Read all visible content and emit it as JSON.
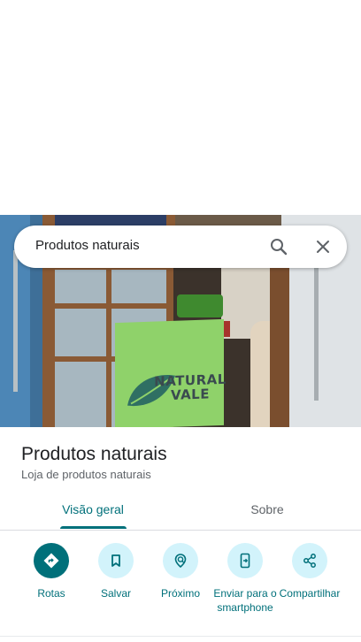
{
  "search": {
    "query": "Produtos naturais"
  },
  "place": {
    "name": "Produtos naturais",
    "category": "Loja de produtos naturais",
    "photo_sign_text": "NATURAL VALE"
  },
  "tabs": [
    {
      "label": "Visão geral",
      "active": true
    },
    {
      "label": "Sobre",
      "active": false
    }
  ],
  "actions": [
    {
      "label": "Rotas",
      "icon": "directions-icon"
    },
    {
      "label": "Salvar",
      "icon": "bookmark-icon"
    },
    {
      "label": "Próximo",
      "icon": "nearby-icon"
    },
    {
      "label": "Enviar para o smartphone",
      "icon": "send-to-phone-icon"
    },
    {
      "label": "Compartilhar",
      "icon": "share-icon"
    }
  ],
  "colors": {
    "accent": "#00707a",
    "action_bg": "#d2f3fb",
    "sign_green": "#8fd26a"
  }
}
